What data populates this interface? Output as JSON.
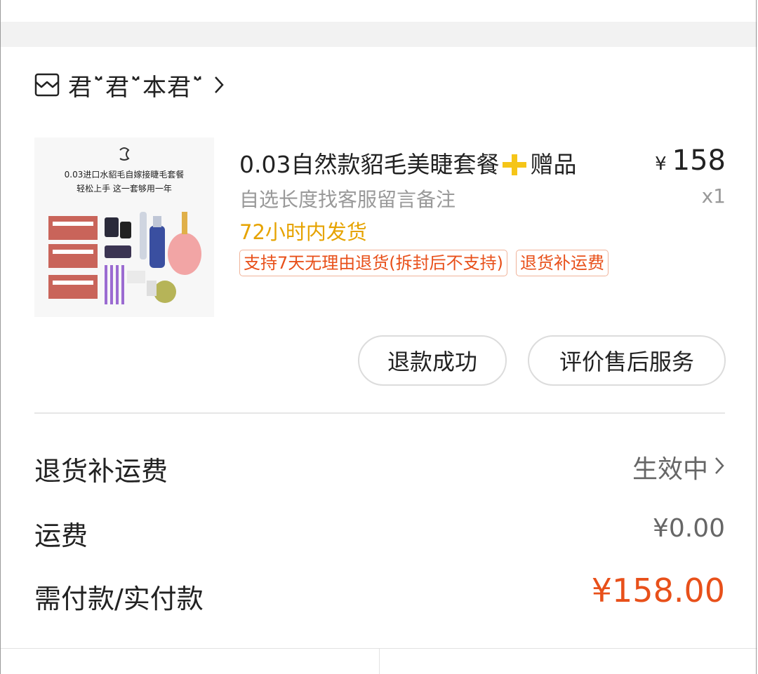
{
  "shop": {
    "name": "君ˇ̈君ˇ̈本君ˇ̈",
    "icon": "shop-icon"
  },
  "product": {
    "image_text_line1": "0.03进口水貂毛自嫁接睫毛套餐",
    "image_text_line2": "轻松上手 这一套够用一年",
    "title_part1": "0.03自然款貂毛美睫套餐",
    "title_part2": "赠品",
    "price_currency": "¥",
    "price": "158",
    "variant": "自选长度找客服留言备注",
    "quantity": "x1",
    "ship_time": "72小时内发货",
    "tags": [
      "支持7天无理由退货(拆封后不支持)",
      "退货补运费"
    ]
  },
  "actions": {
    "refund_label": "退款成功",
    "review_label": "评价售后服务"
  },
  "summary": {
    "return_shipping_label": "退货补运费",
    "return_shipping_status": "生效中",
    "shipping_label": "运费",
    "shipping_value": "¥0.00",
    "paid_label": "需付款/实付款",
    "paid_value": "¥158.00"
  },
  "colors": {
    "accent": "#e8501a",
    "ship_time": "#e6a300",
    "plus": "#f5c518"
  }
}
